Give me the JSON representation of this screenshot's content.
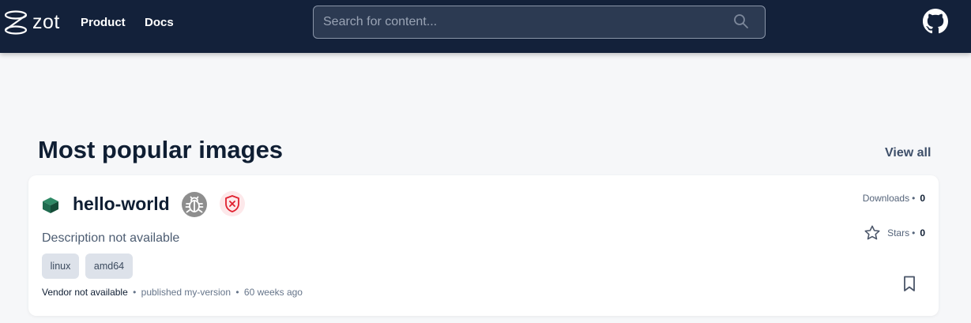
{
  "header": {
    "logo_text": "zot",
    "nav": {
      "product": "Product",
      "docs": "Docs"
    },
    "search": {
      "placeholder": "Search for content...",
      "icon": "search-icon"
    },
    "github_icon": "github-icon"
  },
  "section": {
    "title": "Most popular images",
    "view_all": "View all"
  },
  "card": {
    "name": "hello-world",
    "icons": [
      "cube-icon",
      "bug-icon",
      "shield-x-icon",
      "star-icon",
      "bookmark-icon"
    ],
    "description": "Description not available",
    "tags": [
      "linux",
      "amd64"
    ],
    "vendor": "Vendor not available",
    "published": "published my-version",
    "age": "60 weeks ago",
    "downloads_label": "Downloads",
    "downloads_value": "0",
    "stars_label": "Stars",
    "stars_value": "0",
    "separator": "•"
  },
  "colors": {
    "topbar": "#13213a",
    "page_background": "#f6f7f9",
    "cube": "#1f6b4f",
    "shield": "#e0202f"
  }
}
